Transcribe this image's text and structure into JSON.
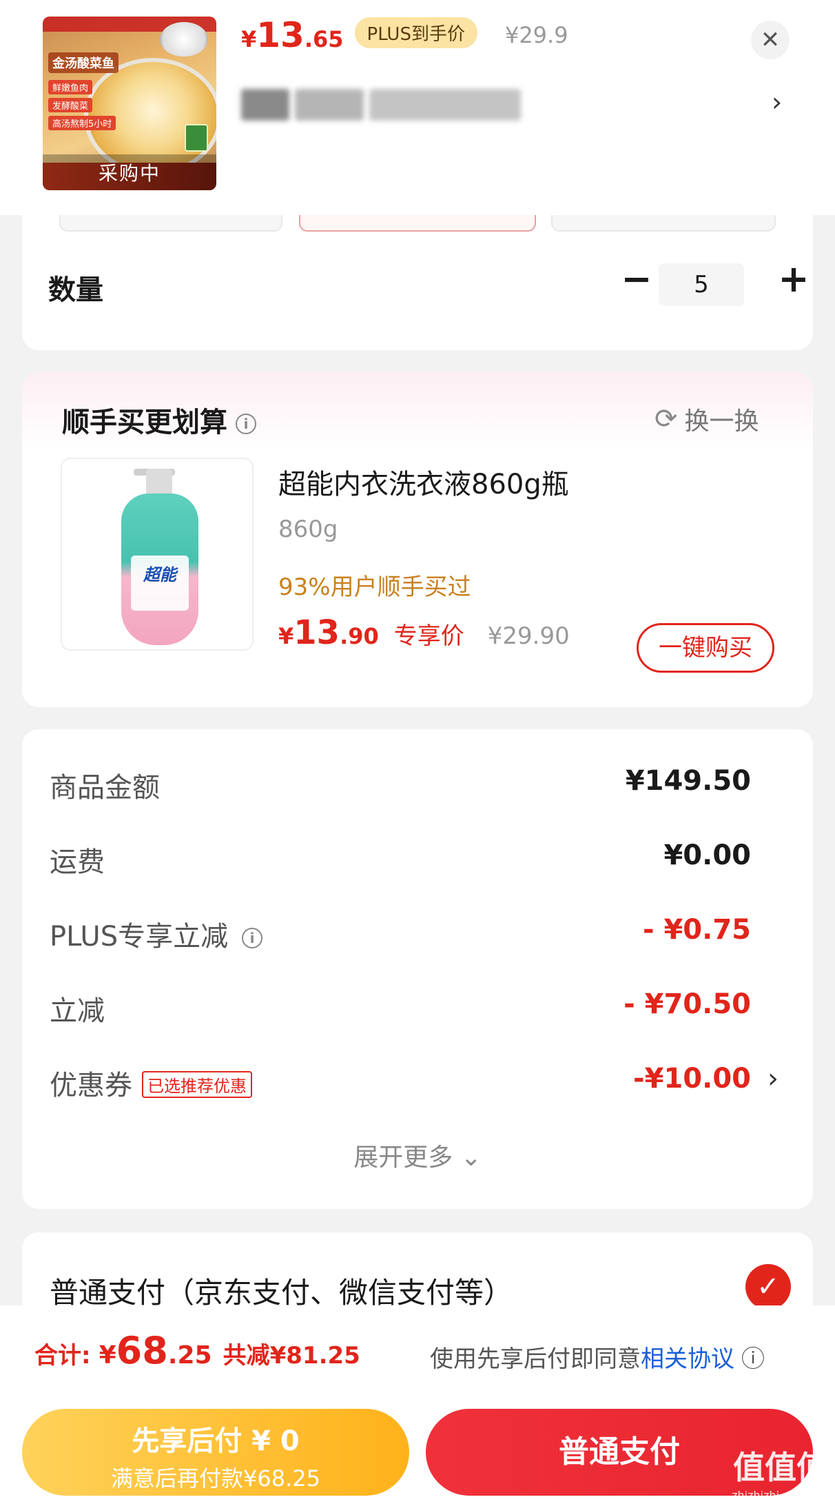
{
  "header": {
    "price_yen": "¥",
    "price_int": "13",
    "price_dec": ".65",
    "plus_tag": "PLUS到手价",
    "orig_price": "¥29.9",
    "close": "✕",
    "spec_chevron": "›",
    "thumb_title": "金汤酸菜鱼",
    "thumb_tags": [
      "鲜嫩鱼肉",
      "发酵酸菜",
      "高汤熬制5小时"
    ],
    "thumb_overlay": "采购中"
  },
  "quantity": {
    "label": "数量",
    "minus": "−",
    "value": "5",
    "plus": "+"
  },
  "addon": {
    "title": "顺手买更划算",
    "info": "i",
    "swap_icon": "⟳",
    "swap_label": "换一换",
    "image_brand": "超能",
    "name": "超能内衣洗衣液860g瓶",
    "spec": "860g",
    "bought": "93%用户顺手买过",
    "price_yen": "¥",
    "price_int": "13",
    "price_dec": ".90",
    "exclusive": "专享价",
    "orig": "¥29.90",
    "buy_button": "一键购买"
  },
  "summary": {
    "goods_label": "商品金额",
    "goods_value": "¥149.50",
    "freight_label": "运费",
    "freight_value": "¥0.00",
    "plus_label": "PLUS专享立减",
    "plus_info": "i",
    "plus_value": "- ¥0.75",
    "discount_label": "立减",
    "discount_value": "- ¥70.50",
    "coupon_label": "优惠券",
    "coupon_chip": "已选推荐优惠",
    "coupon_value": "-¥10.00",
    "coupon_chevron": "›",
    "expand": "展开更多 ⌄"
  },
  "payment": {
    "label": "普通支付（京东支付、微信支付等）",
    "check": "✓"
  },
  "bottom": {
    "total_label": "合计:",
    "total_yen": "¥",
    "total_int": "68",
    "total_dec": ".25",
    "total_saved": "共减¥81.25",
    "agree_prefix": "使用先享后付即同意",
    "agree_link": "相关协议",
    "agree_info": "ⓘ",
    "bnpl_main": "先享后付 ¥ 0",
    "bnpl_sub": "满意后再付款¥68.25",
    "normal_pay": "普通支付"
  },
  "watermark": {
    "main": "值值值",
    "sub": "zhizhizhi.com"
  },
  "colors": {
    "accent_red": "#e1251b",
    "gold": "#ffb21a",
    "link_blue": "#1a5fd8"
  }
}
